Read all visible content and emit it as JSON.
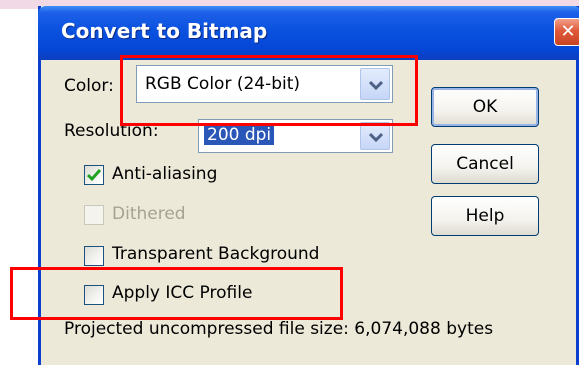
{
  "dialog": {
    "title": "Convert to Bitmap",
    "close_glyph": "✕"
  },
  "color": {
    "label": "Color:",
    "value": "RGB Color (24-bit)"
  },
  "resolution": {
    "label": "Resolution:",
    "value": "200 dpi"
  },
  "buttons": {
    "ok": "OK",
    "cancel": "Cancel",
    "help": "Help"
  },
  "options": [
    {
      "label": "Anti-aliasing",
      "checked": true,
      "enabled": true
    },
    {
      "label": "Dithered",
      "checked": false,
      "enabled": false
    },
    {
      "label": "Transparent Background",
      "checked": false,
      "enabled": true
    },
    {
      "label": "Apply ICC Profile",
      "checked": false,
      "enabled": true
    }
  ],
  "footer": {
    "file_size_text": "Projected uncompressed file size: 6,074,088 bytes"
  },
  "colors": {
    "titlebar": "#0a52e0",
    "window_bg": "#ece9d8",
    "highlight": "#ff0000",
    "check": "#21a121"
  }
}
